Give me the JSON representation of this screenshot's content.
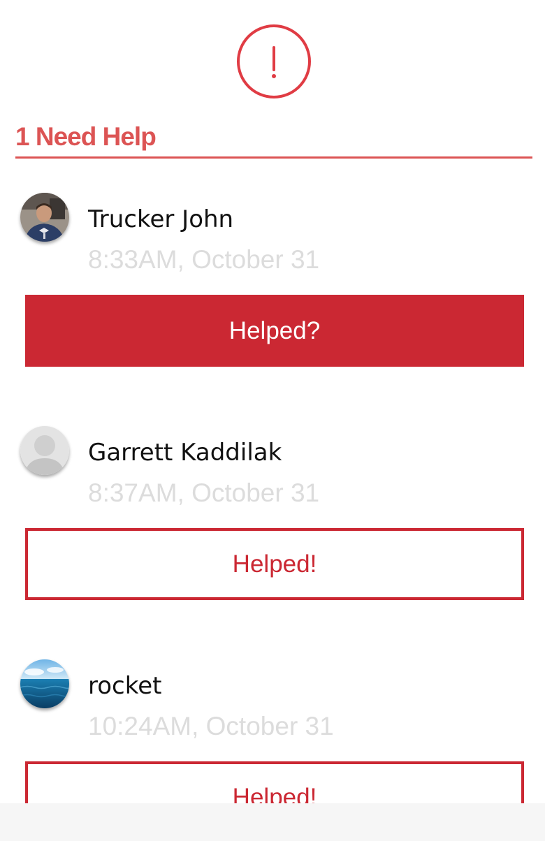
{
  "header": {
    "alert_icon": "exclamation-circle-icon",
    "accent_color": "#cb2833",
    "title_color": "#dc5454",
    "section_title": "1 Need Help"
  },
  "requests": [
    {
      "name": "Trucker John",
      "timestamp": "8:33AM, October 31",
      "avatar": "photo-avatar-man",
      "button_label": "Helped?",
      "button_style": "filled"
    },
    {
      "name": "Garrett Kaddilak",
      "timestamp": "8:37AM, October 31",
      "avatar": "default-avatar",
      "button_label": "Helped!",
      "button_style": "outline"
    },
    {
      "name": "rocket",
      "timestamp": "10:24AM, October 31",
      "avatar": "ocean-avatar",
      "button_label": "Helped!",
      "button_style": "outline"
    }
  ]
}
